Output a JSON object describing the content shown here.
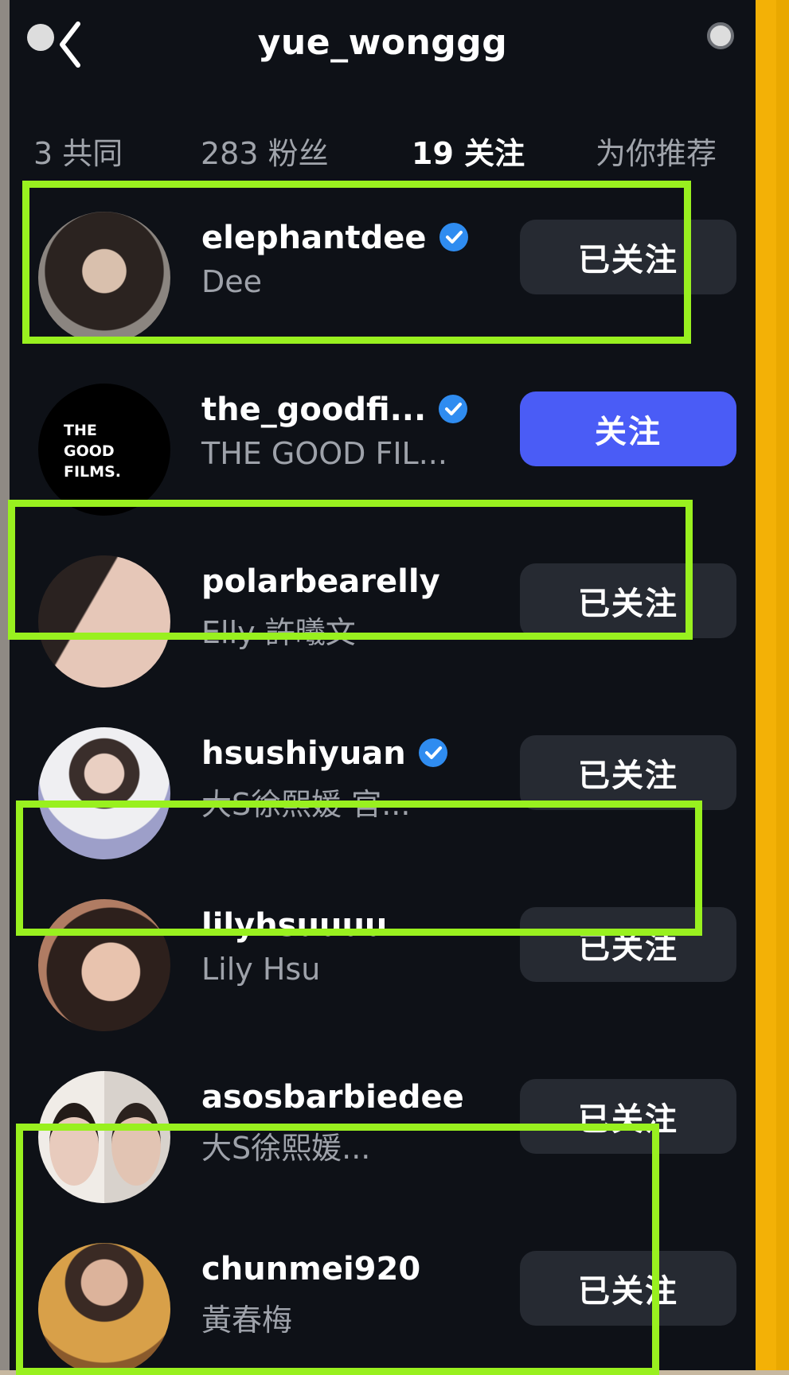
{
  "header": {
    "title": "yue_wonggg"
  },
  "tabs": [
    {
      "label": "3 共同"
    },
    {
      "label": "283 粉丝"
    },
    {
      "label": "19 关注"
    },
    {
      "label": "为你推荐"
    }
  ],
  "users": [
    {
      "username": "elephantdee",
      "display_name": "Dee",
      "verified": true,
      "button": "已关注"
    },
    {
      "username": "the_goodfi...",
      "display_name": "THE GOOD FIL...",
      "verified": true,
      "button": "关注",
      "avatar_text": "THE GOOD FILMS."
    },
    {
      "username": "polarbearelly",
      "display_name": "Elly 許曦文",
      "verified": false,
      "button": "已关注"
    },
    {
      "username": "hsushiyuan",
      "display_name": "大S徐熙媛  官...",
      "verified": true,
      "button": "已关注"
    },
    {
      "username": "lilyhsuuuu",
      "display_name": "Lily Hsu",
      "verified": false,
      "button": "已关注"
    },
    {
      "username": "asosbarbiedee",
      "display_name": "大S徐熙媛...",
      "verified": false,
      "button": "已关注"
    },
    {
      "username": "chunmei920",
      "display_name": "黃春梅",
      "verified": false,
      "button": "已关注"
    }
  ],
  "colors": {
    "highlight": "#99f01f",
    "follow_button": "#4a5cf6",
    "verified": "#2f8cf0"
  }
}
